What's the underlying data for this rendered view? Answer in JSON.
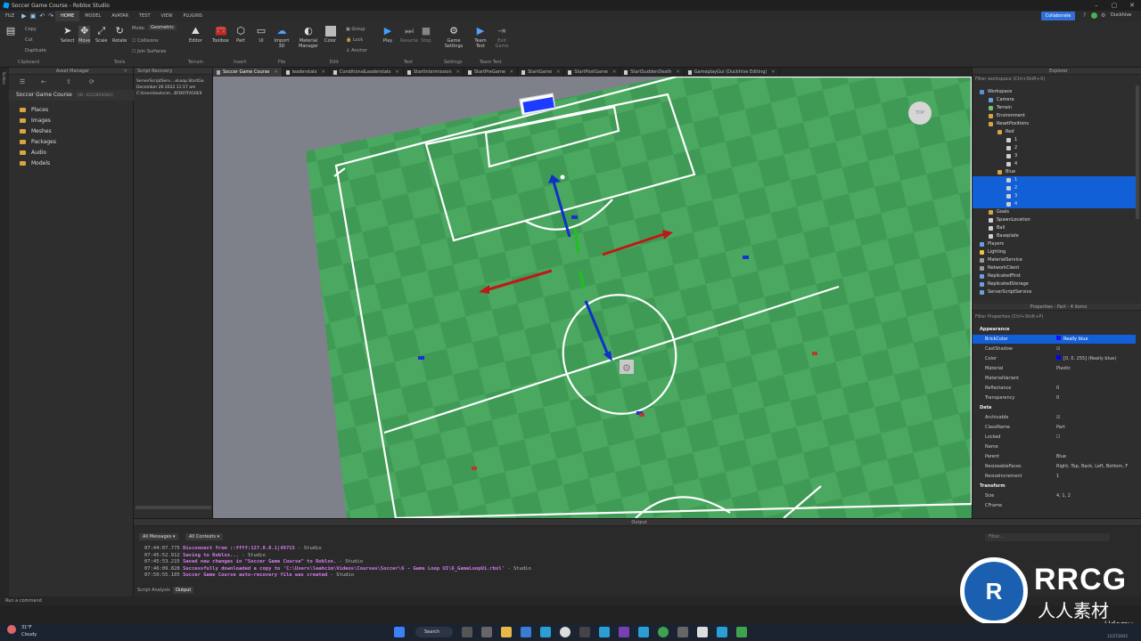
{
  "window": {
    "title": "Soccer Game Course - Roblox Studio",
    "user": "Duckhive"
  },
  "menu": {
    "items": [
      "FILE",
      "HOME",
      "MODEL",
      "AVATAR",
      "TEST",
      "VIEW",
      "PLUGINS"
    ],
    "active": "HOME",
    "collaborate": "Collaborate"
  },
  "ribbon": {
    "clipboard": {
      "copy": "Copy",
      "cut": "Cut",
      "duplicate": "Duplicate",
      "group": "Clipboard"
    },
    "tools": {
      "select": "Select",
      "move": "Move",
      "scale": "Scale",
      "rotate": "Rotate",
      "group": "Tools"
    },
    "mode": {
      "label": "Mode:",
      "value": "Geometric",
      "collisions": "Collisions",
      "join_surfaces": "Join Surfaces"
    },
    "terrain": {
      "editor": "Editor",
      "group": "Terrain"
    },
    "insert": {
      "toolbox": "Toolbox",
      "part": "Part",
      "ui": "UI",
      "group": "Insert"
    },
    "file": {
      "import3d": "Import 3D",
      "group": "File"
    },
    "edit": {
      "material_manager": "Material Manager",
      "color": "Color",
      "group_btn": "Group",
      "lock": "Lock",
      "anchor": "Anchor",
      "group": "Edit"
    },
    "test": {
      "play": "Play",
      "resume": "Resume",
      "stop": "Stop",
      "group": "Test"
    },
    "settings": {
      "game_settings": "Game Settings",
      "group": "Settings"
    },
    "team_test": {
      "team_test": "Team Test",
      "exit_game": "Exit Game",
      "group": "Team Test"
    }
  },
  "asset_manager": {
    "title": "Asset Manager",
    "game": "Soccer Game Course",
    "game_id": "[ID: 4222859583]",
    "folders": [
      "Places",
      "Images",
      "Meshes",
      "Packages",
      "Audio",
      "Models"
    ]
  },
  "script_recovery": {
    "title": "Script Recovery",
    "lines": [
      "ServerScriptServ....eLoop.StartGa",
      "December 26 2022 11:17 am",
      "C:\\Users\\leahcim...BFB97FA50E9"
    ]
  },
  "tabs": [
    {
      "label": "Soccer Game Course",
      "active": true
    },
    {
      "label": "leaderstats",
      "active": false
    },
    {
      "label": "ConditionalLeaderstats",
      "active": false
    },
    {
      "label": "StartIntermission",
      "active": false
    },
    {
      "label": "StartPreGame",
      "active": false
    },
    {
      "label": "StartGame",
      "active": false
    },
    {
      "label": "StartPostGame",
      "active": false
    },
    {
      "label": "StartSuddenDeath",
      "active": false
    },
    {
      "label": "GameplayGui (Duckhive Editing)",
      "active": false
    }
  ],
  "viewport": {
    "view_cube_label": "TOP"
  },
  "explorer": {
    "title": "Explorer",
    "filter": "Filter workspace (Ctrl+Shift+X)",
    "rows": [
      {
        "label": "Workspace",
        "indent": 0,
        "icon": "#5b8fd6",
        "sel": false
      },
      {
        "label": "Camera",
        "indent": 1,
        "icon": "#6aa0e0",
        "sel": false
      },
      {
        "label": "Terrain",
        "indent": 1,
        "icon": "#6cc46c",
        "sel": false
      },
      {
        "label": "Environment",
        "indent": 1,
        "icon": "#d9a441",
        "sel": false
      },
      {
        "label": "ResetPositions",
        "indent": 1,
        "icon": "#d9a441",
        "sel": false
      },
      {
        "label": "Red",
        "indent": 2,
        "icon": "#d9a441",
        "sel": false
      },
      {
        "label": "1",
        "indent": 3,
        "icon": "#cfcfcf",
        "sel": false
      },
      {
        "label": "2",
        "indent": 3,
        "icon": "#cfcfcf",
        "sel": false
      },
      {
        "label": "3",
        "indent": 3,
        "icon": "#cfcfcf",
        "sel": false
      },
      {
        "label": "4",
        "indent": 3,
        "icon": "#cfcfcf",
        "sel": false
      },
      {
        "label": "Blue",
        "indent": 2,
        "icon": "#d9a441",
        "sel": false
      },
      {
        "label": "1",
        "indent": 3,
        "icon": "#cfcfcf",
        "sel": true
      },
      {
        "label": "2",
        "indent": 3,
        "icon": "#cfcfcf",
        "sel": true
      },
      {
        "label": "3",
        "indent": 3,
        "icon": "#cfcfcf",
        "sel": true
      },
      {
        "label": "4",
        "indent": 3,
        "icon": "#cfcfcf",
        "sel": true
      },
      {
        "label": "Goals",
        "indent": 1,
        "icon": "#d9a441",
        "sel": false
      },
      {
        "label": "SpawnLocation",
        "indent": 1,
        "icon": "#cfcfcf",
        "sel": false
      },
      {
        "label": "Ball",
        "indent": 1,
        "icon": "#cfcfcf",
        "sel": false
      },
      {
        "label": "Baseplate",
        "indent": 1,
        "icon": "#cfcfcf",
        "sel": false
      },
      {
        "label": "Players",
        "indent": 0,
        "icon": "#6aa0e0",
        "sel": false
      },
      {
        "label": "Lighting",
        "indent": 0,
        "icon": "#f0c040",
        "sel": false
      },
      {
        "label": "MaterialService",
        "indent": 0,
        "icon": "#9a9a9a",
        "sel": false
      },
      {
        "label": "NetworkClient",
        "indent": 0,
        "icon": "#9a9a9a",
        "sel": false
      },
      {
        "label": "ReplicatedFirst",
        "indent": 0,
        "icon": "#6aa0e0",
        "sel": false
      },
      {
        "label": "ReplicatedStorage",
        "indent": 0,
        "icon": "#6aa0e0",
        "sel": false
      },
      {
        "label": "ServerScriptService",
        "indent": 0,
        "icon": "#6aa0e0",
        "sel": false
      }
    ]
  },
  "properties": {
    "title": "Properties - Part - 4 items",
    "filter": "Filter Properties (Ctrl+Shift+P)",
    "rows": [
      {
        "name": "Appearance",
        "value": "",
        "sec": true,
        "sel": false,
        "swatch": ""
      },
      {
        "name": "BrickColor",
        "value": "Really blue",
        "sec": false,
        "sel": true,
        "swatch": "#1010ff"
      },
      {
        "name": "CastShadow",
        "value": "☑",
        "sec": false,
        "sel": false,
        "swatch": ""
      },
      {
        "name": "Color",
        "value": "[0, 0, 255] (Really blue)",
        "sec": false,
        "sel": false,
        "swatch": "#0000ff"
      },
      {
        "name": "Material",
        "value": "Plastic",
        "sec": false,
        "sel": false,
        "swatch": ""
      },
      {
        "name": "MaterialVariant",
        "value": "",
        "sec": false,
        "sel": false,
        "swatch": ""
      },
      {
        "name": "Reflectance",
        "value": "0",
        "sec": false,
        "sel": false,
        "swatch": ""
      },
      {
        "name": "Transparency",
        "value": "0",
        "sec": false,
        "sel": false,
        "swatch": ""
      },
      {
        "name": "Data",
        "value": "",
        "sec": true,
        "sel": false,
        "swatch": ""
      },
      {
        "name": "Archivable",
        "value": "☑",
        "sec": false,
        "sel": false,
        "swatch": ""
      },
      {
        "name": "ClassName",
        "value": "Part",
        "sec": false,
        "sel": false,
        "swatch": ""
      },
      {
        "name": "Locked",
        "value": "☐",
        "sec": false,
        "sel": false,
        "swatch": ""
      },
      {
        "name": "Name",
        "value": "",
        "sec": false,
        "sel": false,
        "swatch": ""
      },
      {
        "name": "Parent",
        "value": "Blue",
        "sec": false,
        "sel": false,
        "swatch": ""
      },
      {
        "name": "ResizeableFaces",
        "value": "Right, Top, Back, Left, Bottom, F",
        "sec": false,
        "sel": false,
        "swatch": ""
      },
      {
        "name": "ResizeIncrement",
        "value": "1",
        "sec": false,
        "sel": false,
        "swatch": ""
      },
      {
        "name": "Transform",
        "value": "",
        "sec": true,
        "sel": false,
        "swatch": ""
      },
      {
        "name": "Size",
        "value": "4, 1, 2",
        "sec": false,
        "sel": false,
        "swatch": ""
      },
      {
        "name": "CFrame",
        "value": "",
        "sec": false,
        "sel": false,
        "swatch": ""
      }
    ]
  },
  "output": {
    "title": "Output",
    "filter_messages": "All Messages",
    "filter_contexts": "All Contexts",
    "filter_placeholder": "Filter...",
    "lines": [
      {
        "ts": "07:44:07.775",
        "msg": "Disconnect from ::ffff:127.0.0.1|49715",
        "src": "Studio"
      },
      {
        "ts": "07:45:52.912",
        "msg": "Saving to Roblox...",
        "src": "Studio"
      },
      {
        "ts": "07:45:53.215",
        "msg": "Saved new changes in \"Soccer Game Course\" to Roblox.",
        "src": "Studio"
      },
      {
        "ts": "07:46:09.828",
        "msg": "Successfully downloaded a copy to 'C:\\Users\\leahcim\\Videos\\Courses\\Soccer\\6 - Game Loop UI\\6_GameLoopUi.rbxl'",
        "src": "Studio"
      },
      {
        "ts": "07:50:55.105",
        "msg": "Soccer Game Course auto-recovery file was created",
        "src": "Studio"
      }
    ],
    "bottom_tabs": [
      "Script Analysis",
      "Output"
    ]
  },
  "command_bar": {
    "placeholder": "Run a command"
  },
  "taskbar": {
    "weather_temp": "31°F",
    "weather_desc": "Cloudy",
    "search": "Search",
    "date": "12/27/2022"
  },
  "watermark": {
    "brand": "RRCG",
    "sub": "人人素材",
    "udemy": "Udemy"
  }
}
